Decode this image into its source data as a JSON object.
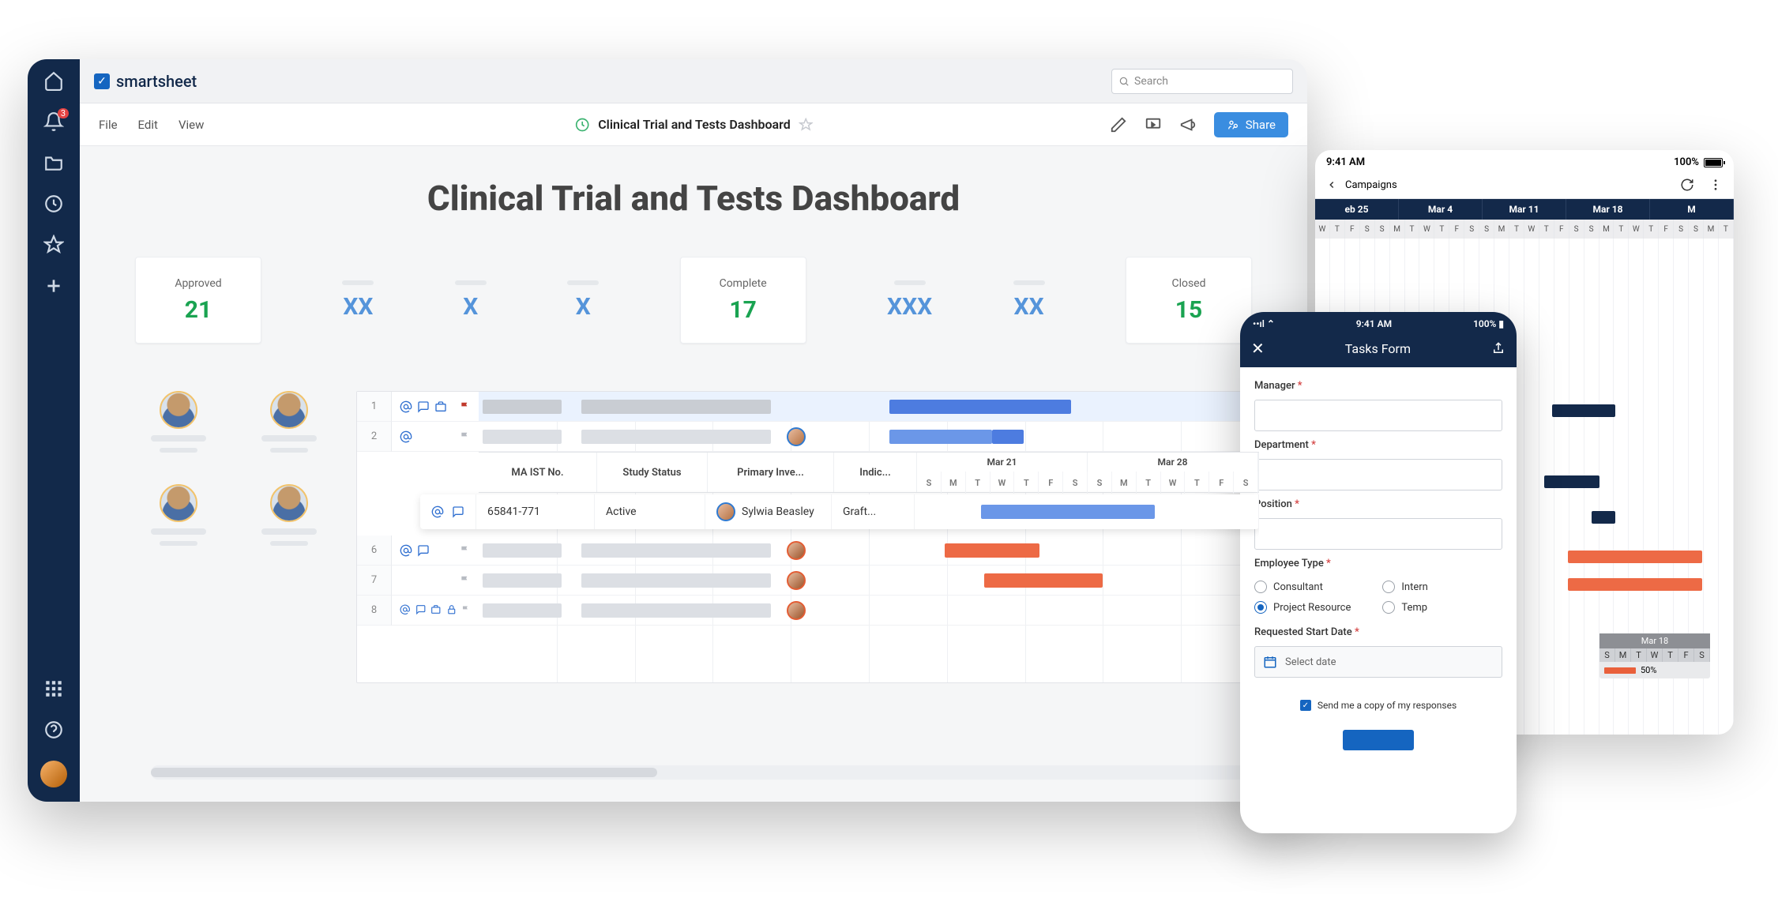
{
  "brand": "smartsheet",
  "search": {
    "placeholder": "Search"
  },
  "sidebar": {
    "notif_count": "3"
  },
  "menus": {
    "file": "File",
    "edit": "Edit",
    "view": "View"
  },
  "doc": {
    "title": "Clinical Trial and Tests Dashboard"
  },
  "share": {
    "label": "Share"
  },
  "page": {
    "title": "Clinical Trial and Tests Dashboard"
  },
  "kpis": [
    {
      "label": "Approved",
      "value": "21"
    },
    {
      "ghost": "XX"
    },
    {
      "ghost": "X"
    },
    {
      "ghost": "X"
    },
    {
      "label": "Complete",
      "value": "17"
    },
    {
      "ghost": "XXX"
    },
    {
      "ghost": "XX"
    },
    {
      "label": "Closed",
      "value": "15"
    }
  ],
  "grid": {
    "cols": {
      "c1": "MA IST No.",
      "c2": "Study Status",
      "c3": "Primary Inve...",
      "c4": "Indic..."
    },
    "rows": [
      "1",
      "2",
      "",
      "",
      "",
      "6",
      "7",
      "8"
    ],
    "months": [
      "Mar 21",
      "Mar 28"
    ],
    "days": [
      "S",
      "M",
      "T",
      "W",
      "T",
      "F",
      "S",
      "S",
      "M",
      "T",
      "W",
      "T",
      "F",
      "S"
    ],
    "focus": {
      "no": "65841-771",
      "status": "Active",
      "pi": "Sylwia Beasley",
      "ind": "Graft..."
    }
  },
  "tablet": {
    "time": "9:41 AM",
    "batt": "100%",
    "crumb": "Campaigns",
    "months": [
      "eb 25",
      "Mar 4",
      "Mar 11",
      "Mar 18",
      "M"
    ],
    "days": [
      "W",
      "T",
      "F",
      "S",
      "S",
      "M",
      "T",
      "W",
      "T",
      "F",
      "S",
      "S",
      "M",
      "T",
      "W",
      "T",
      "F",
      "S",
      "S",
      "M",
      "T",
      "W",
      "T",
      "F",
      "S",
      "S",
      "M",
      "T"
    ],
    "hover": {
      "title": "Mar 18",
      "days": [
        "S",
        "M",
        "T",
        "W",
        "T",
        "F",
        "S"
      ],
      "pct": "50%"
    }
  },
  "phone": {
    "time": "9:41 AM",
    "batt": "100%",
    "title": "Tasks Form",
    "fields": {
      "manager": "Manager",
      "dept": "Department",
      "pos": "Position",
      "emptype_label": "Employee Type",
      "emptype": {
        "o1": "Consultant",
        "o2": "Project Resource",
        "o3": "Intern",
        "o4": "Temp"
      },
      "start_label": "Requested Start Date",
      "start_ph": "Select date",
      "copy": "Send me a copy of my responses"
    }
  }
}
